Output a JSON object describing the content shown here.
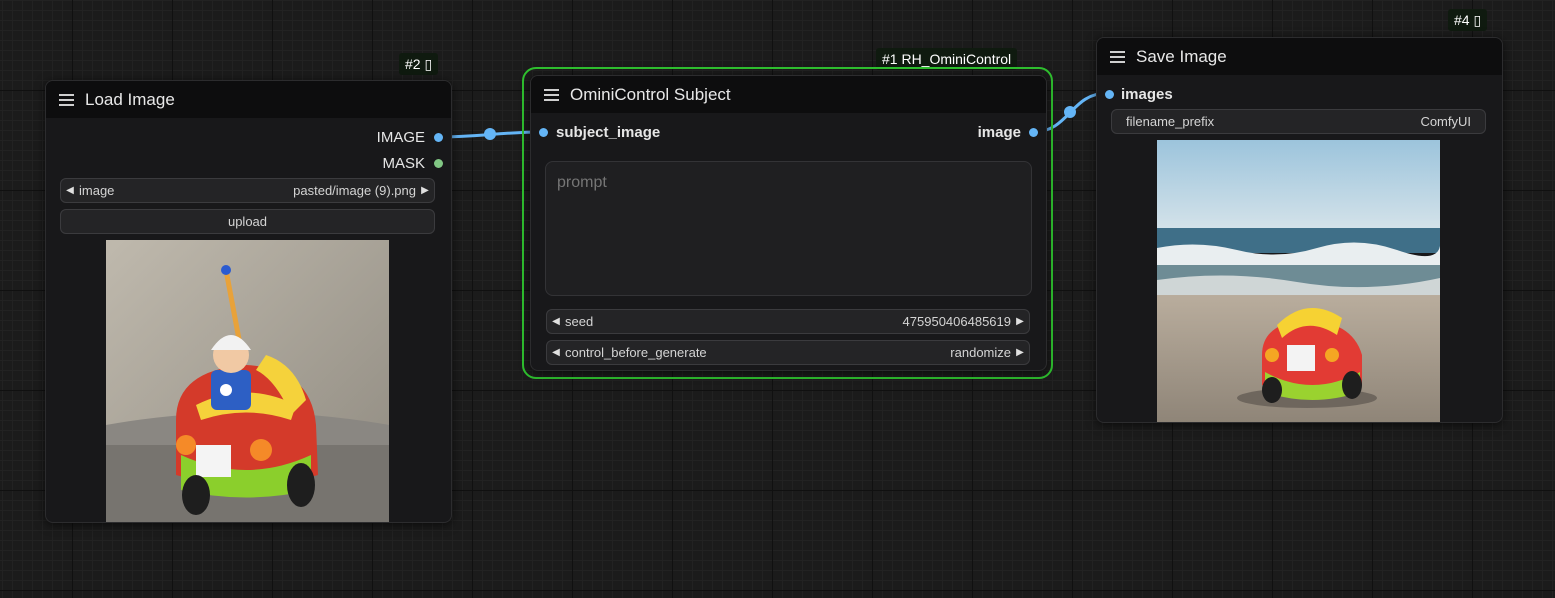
{
  "colors": {
    "canvas": "#1b1b1b",
    "node_body": "#18181a",
    "node_header": "#0d0d0e",
    "selected_outline": "#2fc22f",
    "image_link": "#64b5f6",
    "mask_slot": "#81c784"
  },
  "load_image": {
    "badge": "#2 ▯",
    "title": "Load Image",
    "outputs": [
      "IMAGE",
      "MASK"
    ],
    "image_widget": {
      "label": "image",
      "value": "pasted/image (9).png"
    },
    "upload_label": "upload",
    "preview_icon": "toy-car-photo"
  },
  "omini": {
    "badge": "#1 RH_OminiControl",
    "title": "OminiControl Subject",
    "input": "subject_image",
    "output": "image",
    "prompt_placeholder": "prompt",
    "seed": {
      "label": "seed",
      "value": "475950406485619"
    },
    "control": {
      "label": "control_before_generate",
      "value": "randomize"
    }
  },
  "save_image": {
    "badge": "#4 ▯",
    "title": "Save Image",
    "input": "images",
    "filename_widget": {
      "label": "filename_prefix",
      "value": "ComfyUI"
    },
    "preview_icon": "beach-toy-car-photo"
  }
}
